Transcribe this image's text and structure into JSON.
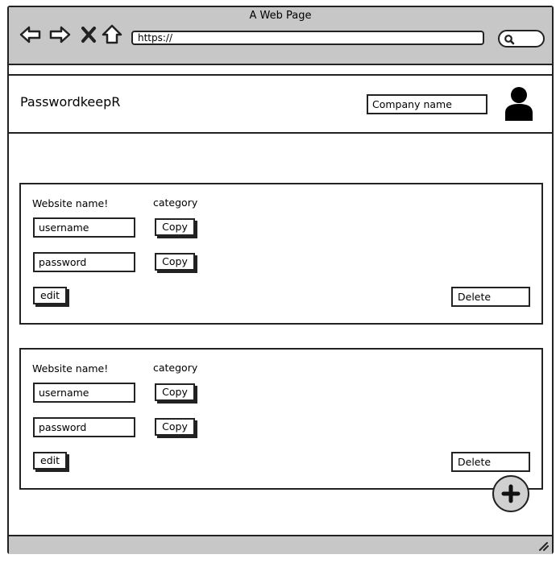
{
  "browser": {
    "title": "A Web Page",
    "url": "https://",
    "icons": [
      "back-arrow-icon",
      "forward-arrow-icon",
      "close-x-icon",
      "home-icon",
      "search-icon"
    ]
  },
  "header": {
    "brand": "PasswordkeepR",
    "company_value": "Company name"
  },
  "cards": [
    {
      "website": "Website name!",
      "category": "category",
      "username": "username",
      "password": "password",
      "copy": "Copy",
      "edit": "edit",
      "delete": "Delete"
    },
    {
      "website": "Website name!",
      "category": "category",
      "username": "username",
      "password": "password",
      "copy": "Copy",
      "edit": "edit",
      "delete": "Delete"
    }
  ],
  "colors": {
    "chrome": "#c7c7c7",
    "stroke": "#222222",
    "fab": "#d0d0d0"
  }
}
